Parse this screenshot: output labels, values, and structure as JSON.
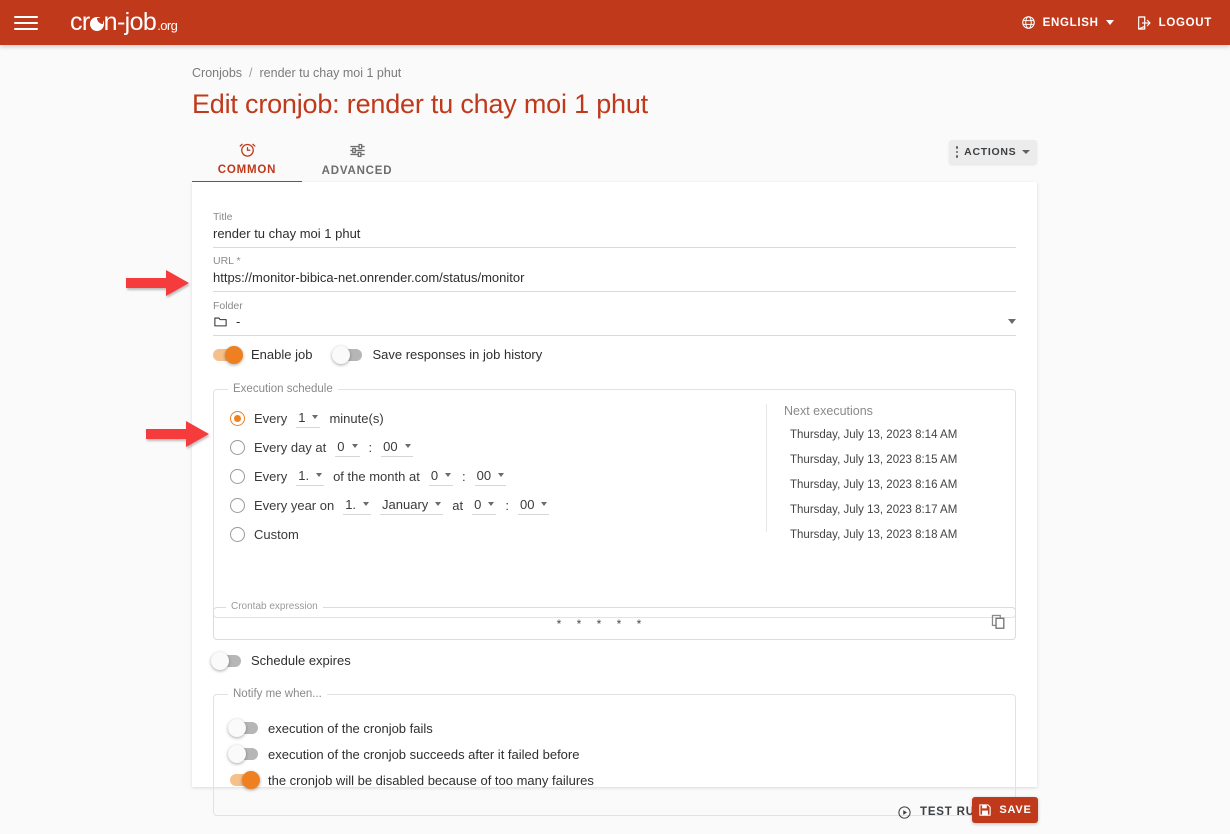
{
  "header": {
    "menu_icon": "hamburger-menu-icon",
    "brand": {
      "part1": "cr",
      "part2": "n-job",
      "tld": ".org"
    },
    "language": {
      "label": "ENGLISH",
      "icon": "globe-icon"
    },
    "logout": {
      "label": "LOGOUT",
      "icon": "logout-icon"
    },
    "bg_color": "#c0391b"
  },
  "breadcrumb": {
    "root": "Cronjobs",
    "separator": "/",
    "current": "render tu chay moi 1 phut"
  },
  "page_title": "Edit cronjob: render tu chay moi 1 phut",
  "actions_button": {
    "label": "ACTIONS"
  },
  "tabs": [
    {
      "label": "COMMON",
      "icon": "alarm-clock-icon",
      "active": true
    },
    {
      "label": "ADVANCED",
      "icon": "tune-sliders-icon",
      "active": false
    }
  ],
  "form": {
    "title": {
      "label": "Title",
      "value": "render tu chay moi 1 phut"
    },
    "url": {
      "label": "URL *",
      "value": "https://monitor-bibica-net.onrender.com/status/monitor"
    },
    "folder": {
      "label": "Folder",
      "value": "-",
      "icon": "folder-icon"
    },
    "toggles": [
      {
        "label": "Enable job",
        "on": true
      },
      {
        "label": "Save responses in job history",
        "on": false
      }
    ]
  },
  "schedule": {
    "legend": "Execution schedule",
    "options": [
      {
        "selected": true,
        "parts": [
          {
            "type": "text",
            "value": "Every"
          },
          {
            "type": "select",
            "value": "1"
          },
          {
            "type": "text",
            "value": "minute(s)"
          }
        ]
      },
      {
        "selected": false,
        "parts": [
          {
            "type": "text",
            "value": "Every day at"
          },
          {
            "type": "select",
            "value": "0"
          },
          {
            "type": "text",
            "value": ":"
          },
          {
            "type": "select",
            "value": "00"
          }
        ]
      },
      {
        "selected": false,
        "parts": [
          {
            "type": "text",
            "value": "Every"
          },
          {
            "type": "select",
            "value": "1."
          },
          {
            "type": "text",
            "value": "of the month at"
          },
          {
            "type": "select",
            "value": "0"
          },
          {
            "type": "text",
            "value": ":"
          },
          {
            "type": "select",
            "value": "00"
          }
        ]
      },
      {
        "selected": false,
        "parts": [
          {
            "type": "text",
            "value": "Every year on"
          },
          {
            "type": "select",
            "value": "1."
          },
          {
            "type": "select",
            "value": "January"
          },
          {
            "type": "text",
            "value": "at"
          },
          {
            "type": "select",
            "value": "0"
          },
          {
            "type": "text",
            "value": ":"
          },
          {
            "type": "select",
            "value": "00"
          }
        ]
      },
      {
        "selected": false,
        "parts": [
          {
            "type": "text",
            "value": "Custom"
          }
        ]
      }
    ],
    "next_executions": {
      "title": "Next executions",
      "items": [
        "Thursday, July 13, 2023 8:14 AM",
        "Thursday, July 13, 2023 8:15 AM",
        "Thursday, July 13, 2023 8:16 AM",
        "Thursday, July 13, 2023 8:17 AM",
        "Thursday, July 13, 2023 8:18 AM"
      ]
    },
    "crontab": {
      "label": "Crontab expression",
      "value": "* * * * *",
      "copy_icon": "copy-icon"
    },
    "expires_toggle": {
      "label": "Schedule expires",
      "on": false
    }
  },
  "notify": {
    "legend": "Notify me when...",
    "toggles": [
      {
        "label": "execution of the cronjob fails",
        "on": false
      },
      {
        "label": "execution of the cronjob succeeds after it failed before",
        "on": false
      },
      {
        "label": "the cronjob will be disabled because of too many failures",
        "on": true
      }
    ]
  },
  "footer": {
    "test_run": {
      "label": "TEST RUN",
      "icon": "play-circle-icon"
    },
    "save": {
      "label": "SAVE",
      "icon": "save-disk-icon",
      "color": "#c0391b"
    }
  },
  "annotations": [
    {
      "name": "arrow-pointing-url-field",
      "color": "#f53b3b"
    },
    {
      "name": "arrow-pointing-every-minute-radio",
      "color": "#f53b3b"
    }
  ]
}
